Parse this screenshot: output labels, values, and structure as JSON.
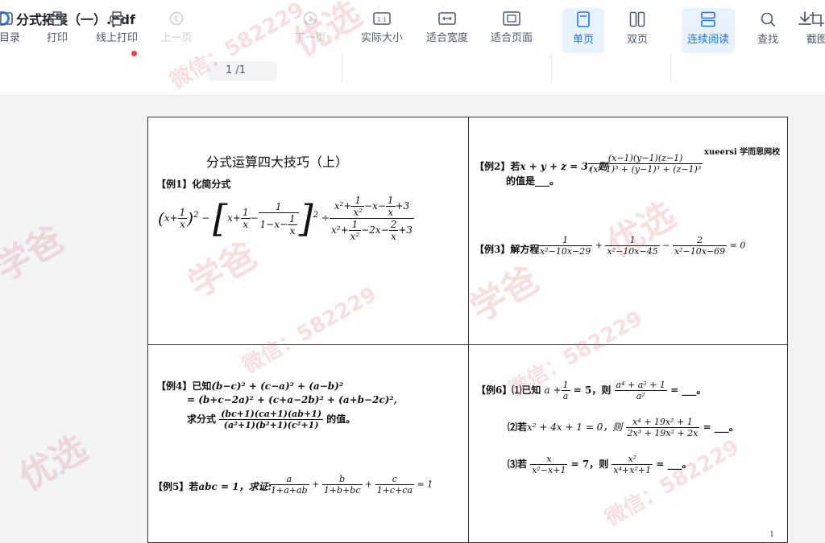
{
  "title_bar": {
    "title": "分式拓展（一）.pdf"
  },
  "toolbar": {
    "catalog": "目录",
    "print": "打印",
    "online_print": "线上打印",
    "prev_page": "上一页",
    "page_indicator": "1 /1",
    "next_page": "下一页",
    "actual_size": "实际大小",
    "fit_width": "适合宽度",
    "fit_page": "适合页面",
    "single_page": "单页",
    "double_page": "双页",
    "continuous": "连续阅读",
    "find": "查找",
    "screenshot": "截图"
  },
  "document": {
    "heading": "分式运算四大技巧（上）",
    "logo": "xueersi 学而思网校",
    "ex1_label": "【例1】化简分式",
    "ex2_label": "【例2】若",
    "ex2_cond": "x + y + z = 3，则",
    "ex2_num": "(x−1)(y−1)(z−1)",
    "ex2_den": "(x−1)³ + (y−1)³ + (z−1)³",
    "ex2_tail": "的值是___。",
    "ex3_label": "【例3】解方程",
    "ex3_eq_tail": "= 0",
    "ex4_label": "【例4】已知",
    "ex4_line1": "(b−c)² + (c−a)² + (a−b)²",
    "ex4_line2": "= (b+c−2a)² + (c+a−2b)² + (a+b−2c)²,",
    "ex4_line3": "求分式",
    "ex4_num": "(bc+1)(ca+1)(ab+1)",
    "ex4_den": "(a²+1)(b²+1)(c²+1)",
    "ex4_tail": "的值。",
    "ex5_label": "【例5】若",
    "ex5_cond": "abc = 1，求证:",
    "ex5_tail": "= 1",
    "ex6_label": "【例6】⑴已知",
    "ex6_1_tail": "= 5，则",
    "ex6_1_num": "a⁴ + a² + 1",
    "ex6_1_den": "a²",
    "ex6_2_label": "⑵若",
    "ex6_2_cond": "x² + 4x + 1 = 0，则",
    "ex6_2_num": "x⁴ + 19x² + 1",
    "ex6_2_den": "2x³ + 19x² + 2x",
    "ex6_3_label": "⑶若",
    "ex6_3_mid": "= 7，则",
    "blank_tail": "= ___。",
    "page_number": "1"
  },
  "watermark": {
    "text_a": "学爸",
    "text_b": "微信：582229",
    "text_c": "优选",
    "color": "#dc6e6e"
  },
  "colors": {
    "accent": "#1677ff",
    "active_bg": "#e8f3ff",
    "badge": "#f53f3f"
  }
}
